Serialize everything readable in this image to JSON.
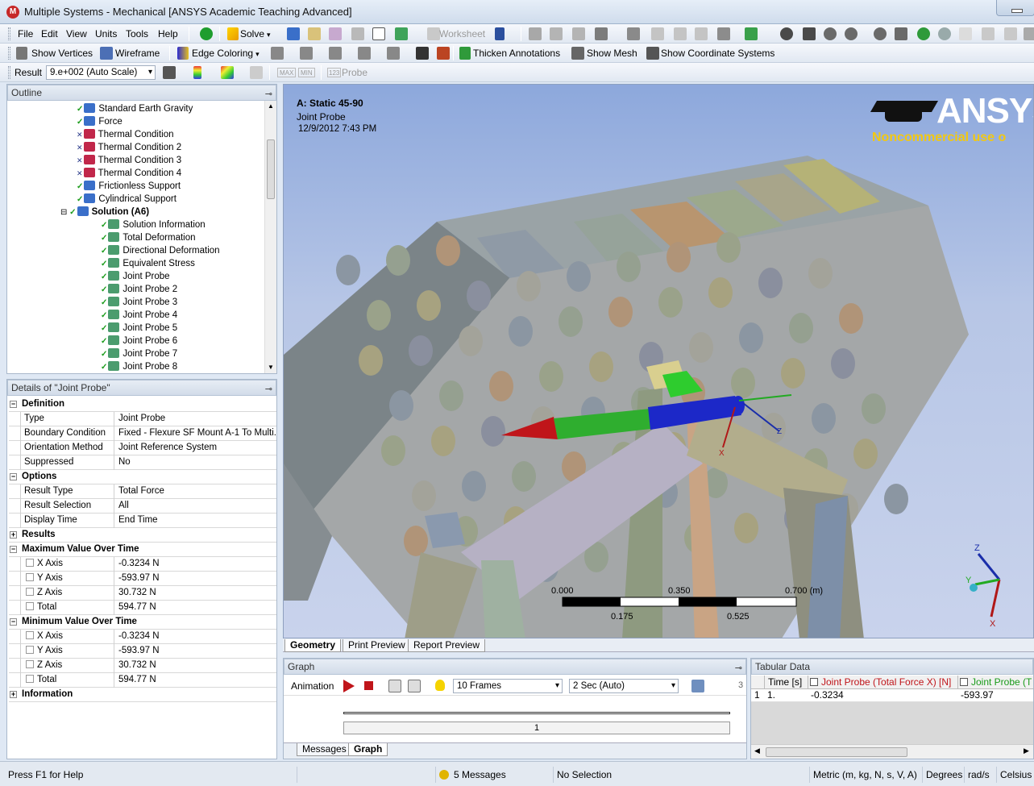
{
  "window": {
    "title": "Multiple Systems - Mechanical [ANSYS Academic Teaching Advanced]",
    "logo": "M"
  },
  "menu": [
    "File",
    "Edit",
    "View",
    "Units",
    "Tools",
    "Help"
  ],
  "toolbar1": {
    "solve": "Solve",
    "worksheet": "Worksheet"
  },
  "toolbar2": {
    "show_vertices": "Show Vertices",
    "wireframe": "Wireframe",
    "edge_coloring": "Edge Coloring",
    "thicken_annotations": "Thicken Annotations",
    "show_mesh": "Show Mesh",
    "show_coordinate_systems": "Show Coordinate Systems"
  },
  "toolbar3": {
    "result_label": "Result",
    "scale": "9.e+002 (Auto Scale)",
    "max": "MAX",
    "min": "MIN",
    "probe": "Probe",
    "probe_prefix": "123"
  },
  "outline": {
    "title": "Outline",
    "items": [
      {
        "label": "Standard Earth Gravity",
        "status": "tick"
      },
      {
        "label": "Force",
        "status": "tick"
      },
      {
        "label": "Thermal Condition",
        "status": "x"
      },
      {
        "label": "Thermal Condition 2",
        "status": "x"
      },
      {
        "label": "Thermal Condition 3",
        "status": "x"
      },
      {
        "label": "Thermal Condition 4",
        "status": "x"
      },
      {
        "label": "Frictionless Support",
        "status": "tick"
      },
      {
        "label": "Cylindrical Support",
        "status": "tick"
      },
      {
        "label": "Solution (A6)",
        "status": "tick",
        "bold": true
      },
      {
        "label": "Solution Information",
        "status": "tick",
        "child": true
      },
      {
        "label": "Total Deformation",
        "status": "tick",
        "child": true
      },
      {
        "label": "Directional Deformation",
        "status": "tick",
        "child": true
      },
      {
        "label": "Equivalent Stress",
        "status": "tick",
        "child": true
      },
      {
        "label": "Joint Probe",
        "status": "tick",
        "child": true
      },
      {
        "label": "Joint Probe 2",
        "status": "tick",
        "child": true
      },
      {
        "label": "Joint Probe 3",
        "status": "tick",
        "child": true
      },
      {
        "label": "Joint Probe 4",
        "status": "tick",
        "child": true
      },
      {
        "label": "Joint Probe 5",
        "status": "tick",
        "child": true
      },
      {
        "label": "Joint Probe 6",
        "status": "tick",
        "child": true
      },
      {
        "label": "Joint Probe 7",
        "status": "tick",
        "child": true
      },
      {
        "label": "Joint Probe 8",
        "status": "tick",
        "child": true
      }
    ]
  },
  "details": {
    "title": "Details of \"Joint Probe\"",
    "rows": [
      {
        "kind": "group",
        "label": "Definition",
        "exp": "minus"
      },
      {
        "label": "Type",
        "value": "Joint Probe"
      },
      {
        "label": "Boundary Condition",
        "value": "Fixed - Flexure SF Mount A-1 To Multi..."
      },
      {
        "label": "Orientation Method",
        "value": "Joint Reference System"
      },
      {
        "label": "Suppressed",
        "value": "No"
      },
      {
        "kind": "group",
        "label": "Options",
        "exp": "minus"
      },
      {
        "label": "Result Type",
        "value": "Total Force"
      },
      {
        "label": "Result Selection",
        "value": "All"
      },
      {
        "label": "Display Time",
        "value": "End Time"
      },
      {
        "kind": "group",
        "label": "Results",
        "exp": "plus"
      },
      {
        "kind": "group",
        "label": "Maximum Value Over Time",
        "exp": "minus"
      },
      {
        "label": "X Axis",
        "value": "-0.3234 N",
        "check": true
      },
      {
        "label": "Y Axis",
        "value": "-593.97 N",
        "check": true
      },
      {
        "label": "Z Axis",
        "value": "30.732 N",
        "check": true
      },
      {
        "label": "Total",
        "value": "594.77 N",
        "check": true
      },
      {
        "kind": "group",
        "label": "Minimum Value Over Time",
        "exp": "minus"
      },
      {
        "label": "X Axis",
        "value": "-0.3234 N",
        "check": true
      },
      {
        "label": "Y Axis",
        "value": "-593.97 N",
        "check": true
      },
      {
        "label": "Z Axis",
        "value": "30.732 N",
        "check": true
      },
      {
        "label": "Total",
        "value": "594.77 N",
        "check": true
      },
      {
        "kind": "group",
        "label": "Information",
        "exp": "plus"
      }
    ]
  },
  "viewport": {
    "analysis": "A: Static 45-90",
    "result": "Joint Probe",
    "date": "12/9/2012 7:43 PM",
    "brand": "ANSYS",
    "noncommercial": "Noncommercial use o",
    "scale_labels": [
      "0.000",
      "0.350",
      "0.700 (m)",
      "0.175",
      "0.525"
    ],
    "triad": {
      "x": "X",
      "y": "Y",
      "z": "Z"
    },
    "joint_labels": {
      "x": "X",
      "z": "Z"
    }
  },
  "view_tabs": [
    "Geometry",
    "Print Preview",
    "Report Preview"
  ],
  "graph": {
    "title": "Graph",
    "animation": "Animation",
    "frames": "10 Frames",
    "duration": "2 Sec (Auto)",
    "frame_count": "3",
    "timeline_value": "1",
    "tabs": [
      "Messages",
      "Graph"
    ]
  },
  "tabular": {
    "title": "Tabular Data",
    "headers": [
      "Time [s]",
      "Joint Probe (Total Force X) [N]",
      "Joint Probe (T"
    ],
    "row": {
      "index": "1",
      "time": "1.",
      "x": "-0.3234",
      "y": "-593.97"
    }
  },
  "status": {
    "help": "Press F1 for Help",
    "messages": "5 Messages",
    "selection": "No Selection",
    "units": "Metric (m, kg, N, s, V, A)",
    "angle": "Degrees",
    "angvel": "rad/s",
    "temp": "Celsius"
  },
  "colors": {
    "accent": "#1e6ec8",
    "ansys_yellow": "#f2c811",
    "tree_tick": "#1a9b1a"
  }
}
